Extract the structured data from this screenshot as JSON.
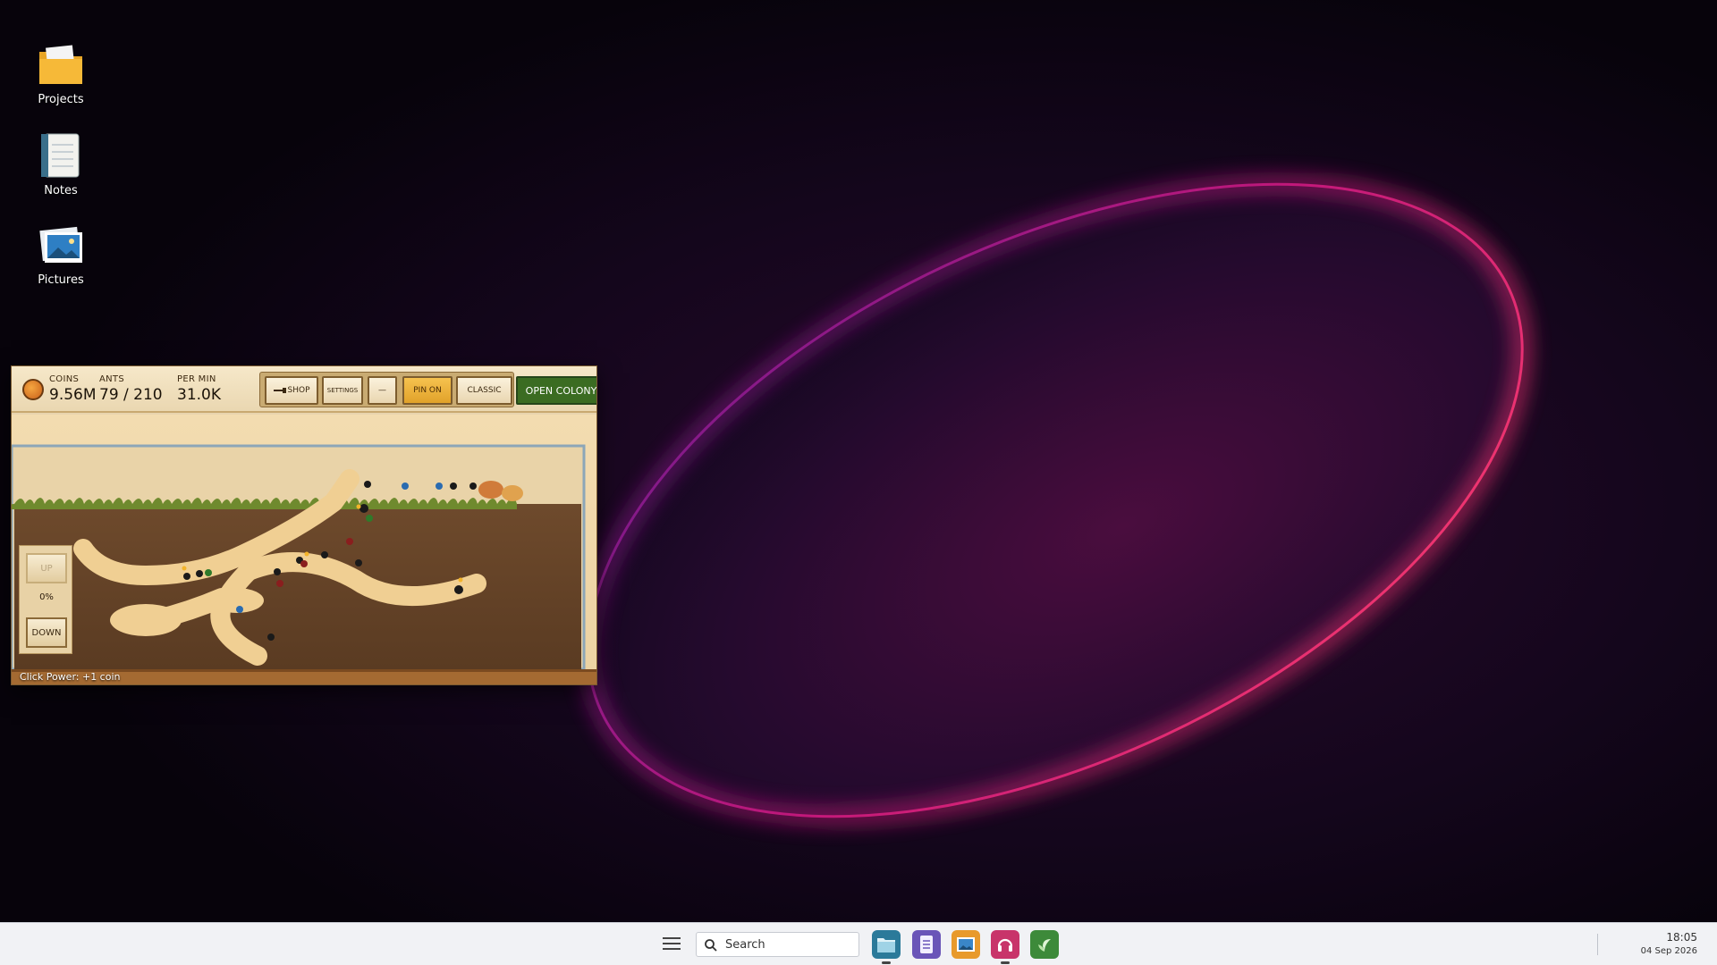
{
  "desktop": {
    "icons": [
      {
        "label": "Projects",
        "icon": "folder-icon"
      },
      {
        "label": "Notes",
        "icon": "notebook-icon"
      },
      {
        "label": "Pictures",
        "icon": "photos-icon"
      }
    ]
  },
  "game": {
    "hud": {
      "coins_label": "COINS",
      "coins_value": "9.56M",
      "ants_label": "ANTS",
      "ants_value": "79 / 210",
      "per_min_label": "PER MIN",
      "per_min_value": "31.0K"
    },
    "buttons": {
      "shop": "SHOP",
      "settings": "SETTINGS",
      "minimize": "—",
      "pin": "PIN ON",
      "classic": "CLASSIC",
      "open_colony": "OPEN COLONY"
    },
    "elevator": {
      "up": "UP",
      "percent": "0%",
      "down": "DOWN"
    },
    "click_power": "Click Power: +1 coin",
    "colors": {
      "accent_green": "#3b6c22",
      "pin_gold": "#e1a22a",
      "soil": "#6b4a2e",
      "tunnel": "#f0cf93"
    }
  },
  "taskbar": {
    "search_placeholder": "Search",
    "apps": [
      "file-manager-icon",
      "notes-app-icon",
      "photos-app-icon",
      "music-app-icon",
      "garden-app-icon"
    ],
    "time": "18:05",
    "date": "04 Sep 2026"
  }
}
